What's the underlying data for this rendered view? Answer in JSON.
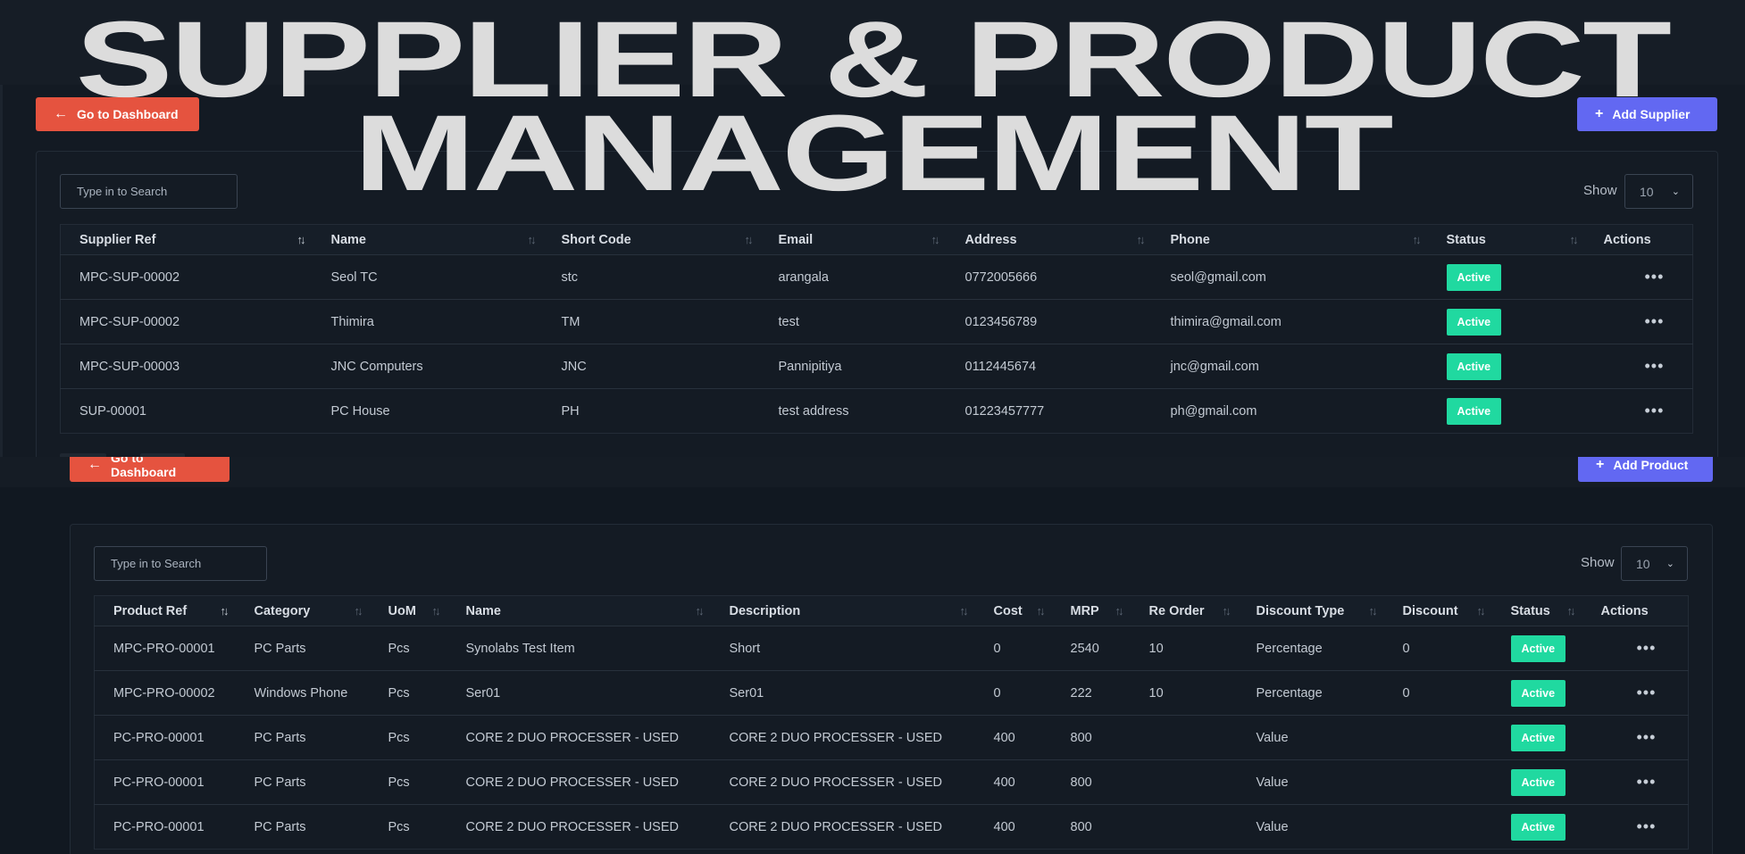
{
  "banner": {
    "line1": "SUPPLIER & PRODUCT",
    "line2": "MANAGEMENT"
  },
  "colors": {
    "background": "#111821",
    "danger": "#e5533f",
    "primary": "#6268f2",
    "success": "#20d9a0"
  },
  "suppliers": {
    "back_button": "Go to Dashboard",
    "add_button": "Add Supplier",
    "search_placeholder": "Type in to Search",
    "show_label": "Show",
    "page_size": "10",
    "columns": [
      "Supplier Ref",
      "Name",
      "Short Code",
      "Email",
      "Address",
      "Phone",
      "Status",
      "Actions"
    ],
    "rows": [
      [
        "MPC-SUP-00002",
        "Seol TC",
        "stc",
        "arangala",
        "0772005666",
        "seol@gmail.com",
        "Active"
      ],
      [
        "MPC-SUP-00002",
        "Thimira",
        "TM",
        "test",
        "0123456789",
        "thimira@gmail.com",
        "Active"
      ],
      [
        "MPC-SUP-00003",
        "JNC Computers",
        "JNC",
        "Pannipitiya",
        "0112445674",
        "jnc@gmail.com",
        "Active"
      ],
      [
        "SUP-00001",
        "PC House",
        "PH",
        "test address",
        "01223457777",
        "ph@gmail.com",
        "Active"
      ]
    ]
  },
  "products": {
    "back_button": "Go to Dashboard",
    "add_button": "Add Product",
    "search_placeholder": "Type in to Search",
    "show_label": "Show",
    "page_size": "10",
    "columns": [
      "Product Ref",
      "Category",
      "UoM",
      "Name",
      "Description",
      "Cost",
      "MRP",
      "Re Order",
      "Discount Type",
      "Discount",
      "Status",
      "Actions"
    ],
    "rows": [
      [
        "MPC-PRO-00001",
        "PC Parts",
        "Pcs",
        "Synolabs Test Item",
        "Short",
        "0",
        "2540",
        "10",
        "Percentage",
        "0",
        "Active"
      ],
      [
        "MPC-PRO-00002",
        "Windows Phone",
        "Pcs",
        "Ser01",
        "Ser01",
        "0",
        "222",
        "10",
        "Percentage",
        "0",
        "Active"
      ],
      [
        "PC-PRO-00001",
        "PC Parts",
        "Pcs",
        "CORE 2 DUO PROCESSER - USED",
        "CORE 2 DUO PROCESSER - USED",
        "400",
        "800",
        "",
        "Value",
        "",
        "Active"
      ],
      [
        "PC-PRO-00001",
        "PC Parts",
        "Pcs",
        "CORE 2 DUO PROCESSER - USED",
        "CORE 2 DUO PROCESSER - USED",
        "400",
        "800",
        "",
        "Value",
        "",
        "Active"
      ],
      [
        "PC-PRO-00001",
        "PC Parts",
        "Pcs",
        "CORE 2 DUO PROCESSER - USED",
        "CORE 2 DUO PROCESSER - USED",
        "400",
        "800",
        "",
        "Value",
        "",
        "Active"
      ]
    ]
  }
}
